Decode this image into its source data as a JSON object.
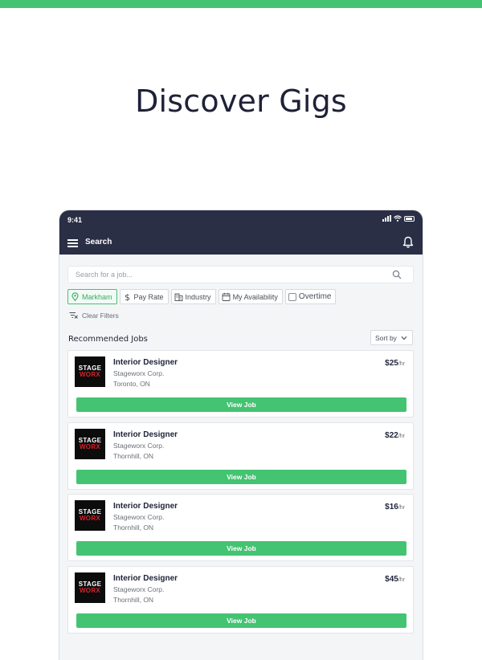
{
  "hero": {
    "title": "Discover Gigs"
  },
  "status_bar": {
    "time": "9:41"
  },
  "app_bar": {
    "title": "Search",
    "menu_icon": "hamburger-menu-icon",
    "bell_icon": "bell-icon"
  },
  "search": {
    "placeholder": "Search for a job...",
    "value": ""
  },
  "filters": [
    {
      "label": "Markham",
      "icon": "location-pin-icon",
      "active": true
    },
    {
      "label": "Pay Rate",
      "icon": "dollar-icon",
      "active": false
    },
    {
      "label": "Industry",
      "icon": "building-icon",
      "active": false
    },
    {
      "label": "My Availability",
      "icon": "calendar-icon",
      "active": false
    },
    {
      "label": "Overtime",
      "icon": "checkbox-icon",
      "active": false
    }
  ],
  "clear_filters": {
    "label": "Clear Filters"
  },
  "recommended": {
    "title": "Recommended Jobs",
    "sort_label": "Sort by"
  },
  "jobs": [
    {
      "logo_line1": "STAGE",
      "logo_line2": "WORX",
      "title": "Interior Designer",
      "company": "Stageworx Corp.",
      "location": "Toronto, ON",
      "rate": "$25",
      "unit": "/hr",
      "button": "View Job"
    },
    {
      "logo_line1": "STAGE",
      "logo_line2": "WORX",
      "title": "Interior Designer",
      "company": "Stageworx Corp.",
      "location": "Thornhill, ON",
      "rate": "$22",
      "unit": "/hr",
      "button": "View Job"
    },
    {
      "logo_line1": "STAGE",
      "logo_line2": "WORX",
      "title": "Interior Designer",
      "company": "Stageworx Corp.",
      "location": "Thornhill, ON",
      "rate": "$16",
      "unit": "/hr",
      "button": "View Job"
    },
    {
      "logo_line1": "STAGE",
      "logo_line2": "WORX",
      "title": "Interior Designer",
      "company": "Stageworx Corp.",
      "location": "Thornhill, ON",
      "rate": "$45",
      "unit": "/hr",
      "button": "View Job"
    }
  ],
  "colors": {
    "accent": "#44c372",
    "header": "#2b2f45",
    "logo_bg": "#0c0c0c",
    "logo_red": "#d3232b"
  }
}
